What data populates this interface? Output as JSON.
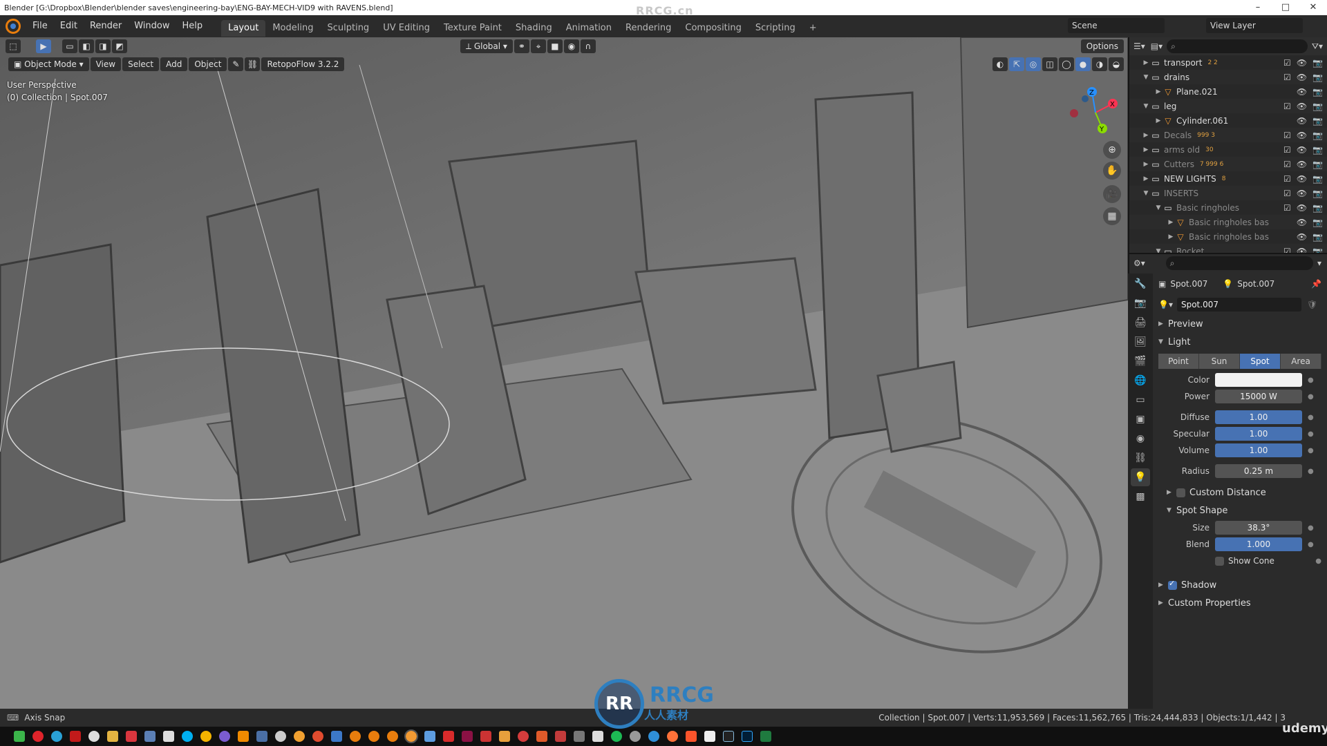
{
  "window": {
    "title": "Blender [G:\\Dropbox\\Blender\\blender saves\\engineering-bay\\ENG-BAY-MECH-VID9 with RAVENS.blend]",
    "watermark": "RRCG.cn"
  },
  "menubar": {
    "menus": [
      "File",
      "Edit",
      "Render",
      "Window",
      "Help"
    ],
    "workspaces": [
      "Layout",
      "Modeling",
      "Sculpting",
      "UV Editing",
      "Texture Paint",
      "Shading",
      "Animation",
      "Rendering",
      "Compositing",
      "Scripting"
    ],
    "active_workspace": "Layout",
    "add_tab": "+",
    "scene": "Scene",
    "view_layer": "View Layer"
  },
  "viewport": {
    "transform_orientation": "Global",
    "options_label": "Options",
    "mode": "Object Mode",
    "menus": [
      "View",
      "Select",
      "Add",
      "Object"
    ],
    "addon": "RetopoFlow 3.2.2",
    "perspective": "User Perspective",
    "collection_info": "(0) Collection | Spot.007",
    "gizmo_axes": [
      "X",
      "Y",
      "Z"
    ]
  },
  "outliner": {
    "rows": [
      {
        "name": "transport",
        "indent": 1,
        "type": "collection",
        "expanded": false,
        "dim": false,
        "extra": "2  2"
      },
      {
        "name": "drains",
        "indent": 1,
        "type": "collection",
        "expanded": true,
        "dim": false,
        "extra": ""
      },
      {
        "name": "Plane.021",
        "indent": 2,
        "type": "object",
        "expanded": false,
        "dim": false,
        "extra": ""
      },
      {
        "name": "leg",
        "indent": 1,
        "type": "collection",
        "expanded": true,
        "dim": false,
        "extra": ""
      },
      {
        "name": "Cylinder.061",
        "indent": 2,
        "type": "object",
        "expanded": false,
        "dim": false,
        "extra": ""
      },
      {
        "name": "Decals",
        "indent": 1,
        "type": "collection",
        "expanded": false,
        "dim": true,
        "extra": "999 3"
      },
      {
        "name": "arms old",
        "indent": 1,
        "type": "collection",
        "expanded": false,
        "dim": true,
        "extra": "30"
      },
      {
        "name": "Cutters",
        "indent": 1,
        "type": "collection",
        "expanded": false,
        "dim": true,
        "extra": "7  999 6"
      },
      {
        "name": "NEW LIGHTS",
        "indent": 1,
        "type": "collection",
        "expanded": false,
        "dim": false,
        "extra": "8"
      },
      {
        "name": "INSERTS",
        "indent": 1,
        "type": "collection",
        "expanded": true,
        "dim": true,
        "extra": ""
      },
      {
        "name": "Basic ringholes",
        "indent": 2,
        "type": "collection",
        "expanded": true,
        "dim": true,
        "extra": ""
      },
      {
        "name": "Basic ringholes bas",
        "indent": 3,
        "type": "object",
        "expanded": false,
        "dim": true,
        "extra": ""
      },
      {
        "name": "Basic ringholes bas",
        "indent": 3,
        "type": "object",
        "expanded": false,
        "dim": true,
        "extra": ""
      },
      {
        "name": "Rocket",
        "indent": 2,
        "type": "collection",
        "expanded": true,
        "dim": true,
        "extra": ""
      }
    ]
  },
  "properties": {
    "object_name": "Spot.007",
    "data_name": "Spot.007",
    "datablock": "Spot.007",
    "sections": {
      "preview": "Preview",
      "light": "Light",
      "custom_distance": "Custom Distance",
      "spot_shape": "Spot Shape",
      "shadow": "Shadow",
      "custom_properties": "Custom Properties"
    },
    "light_types": [
      "Point",
      "Sun",
      "Spot",
      "Area"
    ],
    "active_light_type": "Spot",
    "fields": {
      "color_label": "Color",
      "power_label": "Power",
      "power": "15000 W",
      "diffuse_label": "Diffuse",
      "diffuse": "1.00",
      "specular_label": "Specular",
      "specular": "1.00",
      "volume_label": "Volume",
      "volume": "1.00",
      "radius_label": "Radius",
      "radius": "0.25 m",
      "size_label": "Size",
      "size": "38.3°",
      "blend_label": "Blend",
      "blend": "1.000",
      "show_cone": "Show Cone"
    },
    "light_color": "#ffffff"
  },
  "statusbar": {
    "left": "Axis Snap",
    "right": "Collection | Spot.007 | Verts:11,953,569 | Faces:11,562,765 | Tris:24,444,833 | Objects:1/1,442 | 3"
  },
  "overlay": {
    "logo_mark": "RR",
    "logo_text": "RRCG",
    "logo_sub": "人人素材",
    "udemy": "udemy"
  },
  "colors": {
    "accent": "#4772b3",
    "blender_orange": "#e87d0d",
    "panel": "#2b2b2b"
  }
}
